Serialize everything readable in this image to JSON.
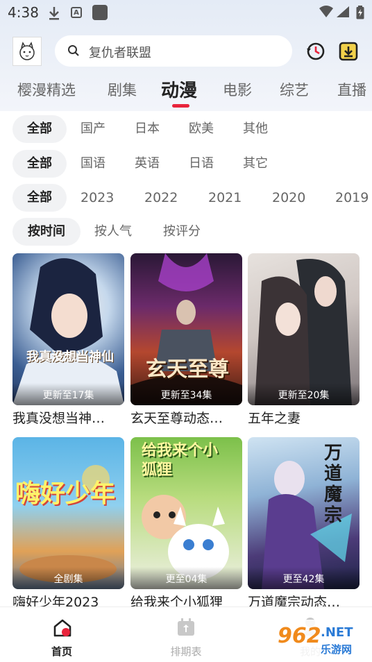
{
  "status_bar": {
    "time": "4:38"
  },
  "search": {
    "placeholder": "复仇者联盟"
  },
  "tabs": [
    {
      "label": "樱漫精选"
    },
    {
      "label": "剧集"
    },
    {
      "label": "动漫",
      "active": true
    },
    {
      "label": "电影"
    },
    {
      "label": "综艺"
    },
    {
      "label": "直播"
    }
  ],
  "filters": {
    "region": [
      "全部",
      "国产",
      "日本",
      "欧美",
      "其他"
    ],
    "language": [
      "全部",
      "国语",
      "英语",
      "日语",
      "其它"
    ],
    "year": [
      "全部",
      "2023",
      "2022",
      "2021",
      "2020",
      "2019"
    ],
    "sort": [
      "按时间",
      "按人气",
      "按评分"
    ]
  },
  "cards": [
    {
      "title": "我真没想当神…",
      "badge": "更新至17集",
      "overlay": "我真没想当神仙"
    },
    {
      "title": "玄天至尊动态…",
      "badge": "更新至34集",
      "overlay": "玄天至尊"
    },
    {
      "title": "五年之妻",
      "badge": "更新至20集",
      "overlay": ""
    },
    {
      "title": "嗨好少年2023",
      "badge": "全剧集",
      "overlay": "嗨好少年"
    },
    {
      "title": "给我来个小狐狸",
      "badge": "更至04集",
      "overlay": "给我来个小狐狸"
    },
    {
      "title": "万道魔宗动态…",
      "badge": "更至42集",
      "overlay": "万道魔宗"
    }
  ],
  "bottom_nav": [
    {
      "label": "首页",
      "icon": "home-icon",
      "active": true
    },
    {
      "label": "排期表",
      "icon": "calendar-icon"
    },
    {
      "label": "我的",
      "icon": "user-icon"
    }
  ],
  "watermark": {
    "number": "962",
    "suffix": ".NET",
    "site": "乐游网"
  },
  "colors": {
    "accent": "#e8233b",
    "top_bg": "#e9eef7",
    "chip_bg": "#f1f2f4"
  }
}
